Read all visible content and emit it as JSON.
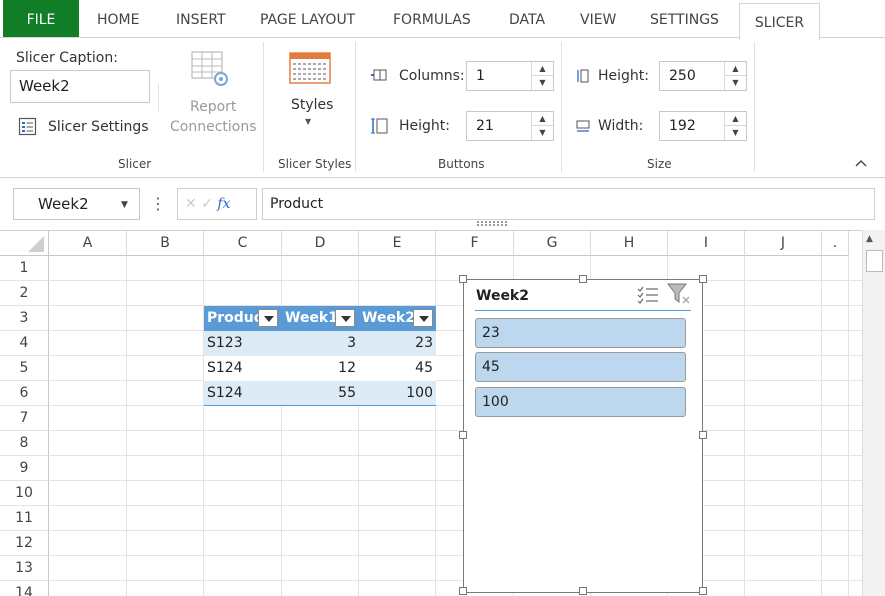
{
  "tabs": {
    "file": "FILE",
    "home": "HOME",
    "insert": "INSERT",
    "page_layout": "PAGE LAYOUT",
    "formulas": "FORMULAS",
    "data": "DATA",
    "view": "VIEW",
    "settings": "SETTINGS",
    "slicer": "SLICER"
  },
  "ribbon": {
    "slicer_group": {
      "caption_label": "Slicer Caption:",
      "caption_value": "Week2",
      "settings_label": "Slicer Settings",
      "report_line1": "Report",
      "report_line2": "Connections",
      "group_label": "Slicer"
    },
    "styles_group": {
      "styles_label": "Styles",
      "group_label": "Slicer Styles"
    },
    "buttons_group": {
      "columns_label": "Columns:",
      "columns_value": "1",
      "height_label": "Height:",
      "height_value": "21",
      "group_label": "Buttons"
    },
    "size_group": {
      "height_label": "Height:",
      "height_value": "250",
      "width_label": "Width:",
      "width_value": "192",
      "group_label": "Size"
    },
    "collapse_glyph": "^"
  },
  "formula_bar": {
    "name_box": "Week2",
    "fx_label": "fx",
    "cancel_glyph": "✕",
    "enter_glyph": "✓",
    "formula_value": "Product"
  },
  "grid": {
    "columns": [
      "A",
      "B",
      "C",
      "D",
      "E",
      "F",
      "G",
      "H",
      "I",
      "J",
      "."
    ],
    "rows": [
      "1",
      "2",
      "3",
      "4",
      "5",
      "6",
      "7",
      "8",
      "9",
      "10",
      "11",
      "12",
      "13",
      "14"
    ]
  },
  "table": {
    "headers": [
      "Product",
      "Week1",
      "Week2"
    ],
    "rows": [
      [
        "S123",
        "3",
        "23"
      ],
      [
        "S124",
        "12",
        "45"
      ],
      [
        "S124",
        "55",
        "100"
      ]
    ]
  },
  "slicer": {
    "title": "Week2",
    "items": [
      "23",
      "45",
      "100"
    ]
  },
  "colors": {
    "file_tab": "#117d27",
    "table_header": "#5b9bd5",
    "table_band": "#ddebf7",
    "slicer_item": "#bdd7ee"
  }
}
